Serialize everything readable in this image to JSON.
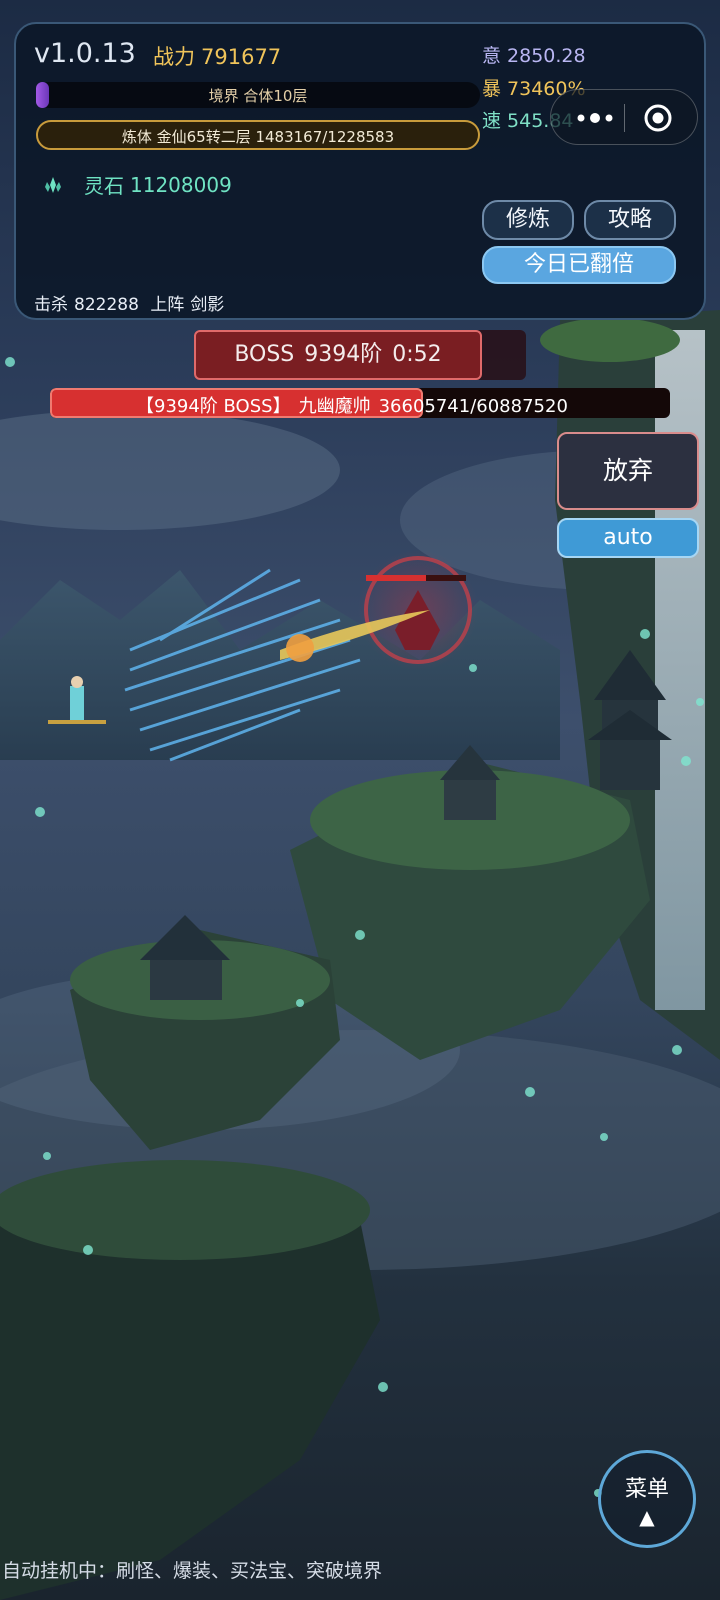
{
  "hud": {
    "version": "v1.0.13",
    "power_label": "战力",
    "power_value": "791677",
    "stats": {
      "yi_label": "意",
      "yi_value": "2850.28",
      "bao_label": "暴",
      "bao_value": "73460%",
      "su_label": "速",
      "su_value": "545.84"
    },
    "realm_text": "境界 合体10层",
    "realm_progress": 0.02,
    "body_text": "炼体 金仙65转二层  1483167/1228583",
    "stone_label": "灵石",
    "stone_value": "11208009",
    "buttons": {
      "train": "修炼",
      "guide": "攻略",
      "double": "今日已翻倍"
    },
    "kills_label": "击杀",
    "kills_value": "822288",
    "deploy_label": "上阵",
    "deploy_value": "剑影"
  },
  "capsule": {
    "more_icon": "more-dots-icon",
    "close_icon": "target-circle-icon"
  },
  "boss": {
    "timer_label": "BOSS",
    "timer_level": "9394阶",
    "timer_time": "0:52",
    "hp_tag": "【9394阶 BOSS】",
    "hp_name": "九幽魔帅",
    "hp_text": "36605741/60887520",
    "hp_current": 36605741,
    "hp_max": 60887520
  },
  "buttons": {
    "give_up": "放弃",
    "auto": "auto"
  },
  "menu": {
    "label": "菜单",
    "arrow": "▲"
  },
  "status_line": "自动挂机中：刷怪、爆装、买法宝、突破境界",
  "colors": {
    "accent_gold": "#f0c45a",
    "accent_teal": "#6fe3c3",
    "boss_red": "#d73030",
    "button_blue": "#5aa6e0"
  }
}
